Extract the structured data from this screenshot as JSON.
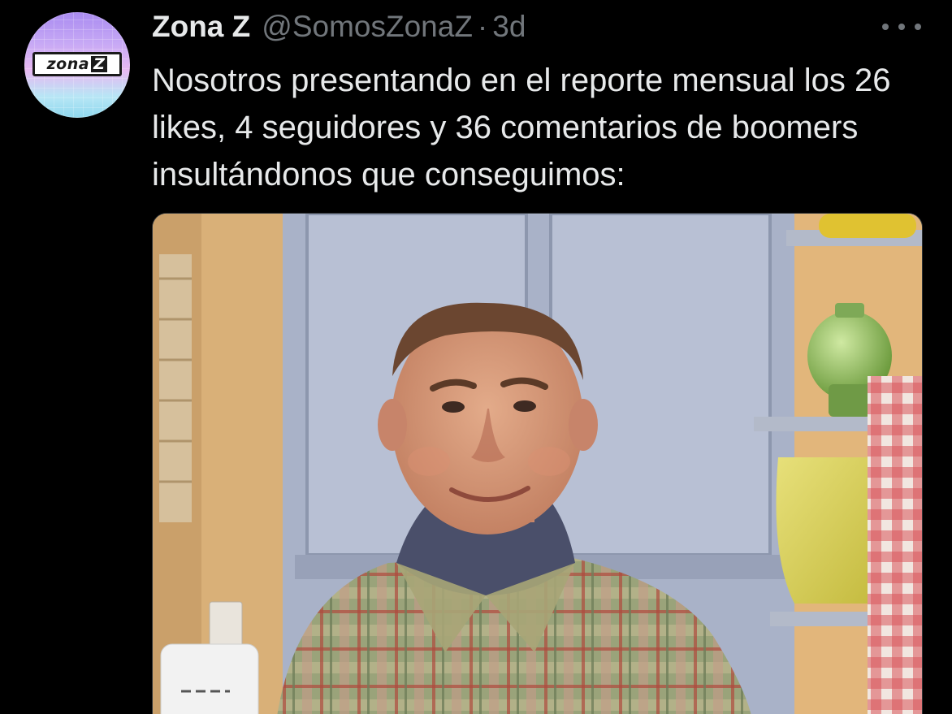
{
  "tweet": {
    "author": {
      "display_name": "Zona Z",
      "handle": "@SomosZonaZ",
      "avatar_logo_text": "zona",
      "avatar_logo_mark": "Z"
    },
    "separator": "·",
    "timestamp": "3d",
    "more_icon": "more-horizontal-icon",
    "text": "Nosotros presentando en el reporte mensual los 26 likes, 4 seguidores y 36 comentarios de boomers insultándonos que conseguimos:",
    "media": {
      "type": "photo"
    }
  },
  "colors": {
    "background": "#000000",
    "primary_text": "#e7e9ea",
    "secondary_text": "#71767b",
    "border": "#2f3336"
  }
}
